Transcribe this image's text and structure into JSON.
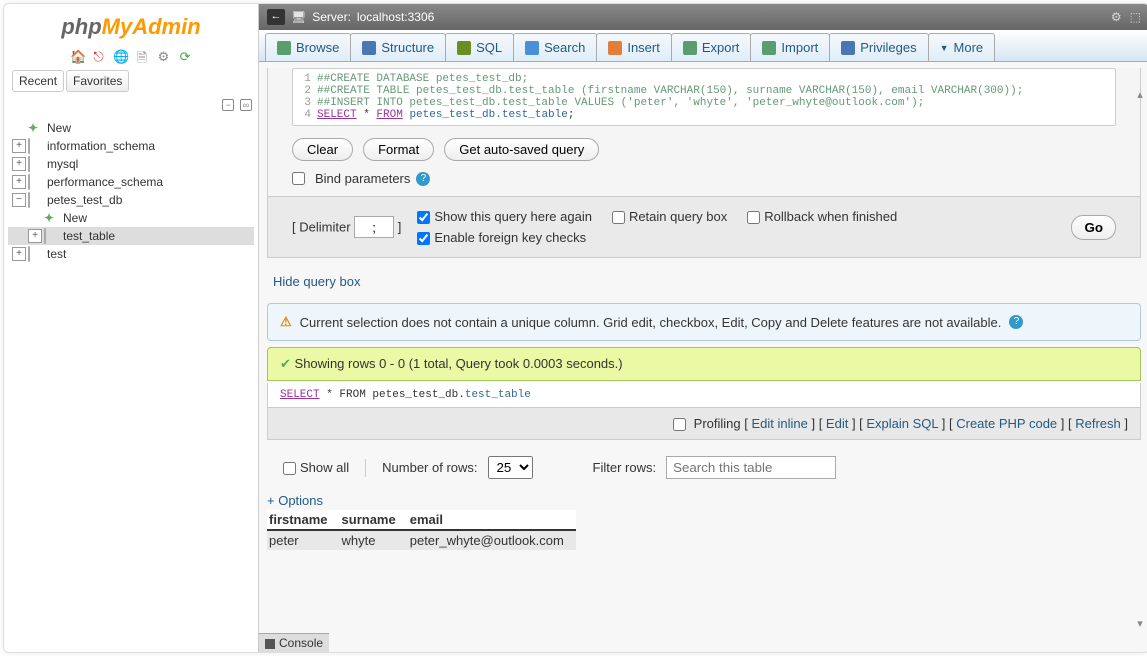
{
  "logo": {
    "php": "php",
    "myadmin": "MyAdmin"
  },
  "sidebar": {
    "tabs": [
      "Recent",
      "Favorites"
    ],
    "tree": [
      {
        "label": "New",
        "type": "new",
        "indent": 0
      },
      {
        "label": "information_schema",
        "type": "db",
        "indent": 0,
        "toggle": "+"
      },
      {
        "label": "mysql",
        "type": "db",
        "indent": 0,
        "toggle": "+"
      },
      {
        "label": "performance_schema",
        "type": "db",
        "indent": 0,
        "toggle": "+"
      },
      {
        "label": "petes_test_db",
        "type": "db",
        "indent": 0,
        "toggle": "−"
      },
      {
        "label": "New",
        "type": "new",
        "indent": 1
      },
      {
        "label": "test_table",
        "type": "table",
        "indent": 1,
        "toggle": "+",
        "selected": true
      },
      {
        "label": "test",
        "type": "db",
        "indent": 0,
        "toggle": "+"
      }
    ]
  },
  "server": {
    "label": "Server:",
    "value": "localhost:3306"
  },
  "tabs": [
    {
      "label": "Browse",
      "icon": "#5a9e6f"
    },
    {
      "label": "Structure",
      "icon": "#4a77b4"
    },
    {
      "label": "SQL",
      "icon": "#6b8e23"
    },
    {
      "label": "Search",
      "icon": "#4a90d9"
    },
    {
      "label": "Insert",
      "icon": "#e27d3a"
    },
    {
      "label": "Export",
      "icon": "#5a9e6f"
    },
    {
      "label": "Import",
      "icon": "#5a9e6f"
    },
    {
      "label": "Privileges",
      "icon": "#4a77b4"
    },
    {
      "label": "More",
      "icon": "#333",
      "caret": true
    }
  ],
  "code": [
    {
      "n": "1",
      "text": "##CREATE DATABASE petes_test_db;",
      "cls": "cm-comment"
    },
    {
      "n": "2",
      "text": "##CREATE TABLE petes_test_db.test_table (firstname VARCHAR(150), surname VARCHAR(150), email VARCHAR(300));",
      "cls": "cm-comment"
    },
    {
      "n": "3",
      "text": "##INSERT INTO petes_test_db.test_table VALUES ('peter', 'whyte', 'peter_whyte@outlook.com');",
      "cls": "cm-comment"
    },
    {
      "n": "4",
      "html": "<span class='cm-keyword'>SELECT</span> * <span class='cm-keyword'>FROM</span> <span class='cm-table'>petes_test_db.test_table</span>;"
    }
  ],
  "buttons": {
    "clear": "Clear",
    "format": "Format",
    "autosaved": "Get auto-saved query"
  },
  "bind": {
    "label": "Bind parameters"
  },
  "opts": {
    "delimiter_label": "Delimiter",
    "delimiter_value": ";",
    "show_again": "Show this query here again",
    "retain": "Retain query box",
    "rollback": "Rollback when finished",
    "fk": "Enable foreign key checks",
    "go": "Go"
  },
  "hide_link": "Hide query box",
  "alert": "Current selection does not contain a unique column. Grid edit, checkbox, Edit, Copy and Delete features are not available.",
  "success": "Showing rows 0 - 0 (1 total, Query took 0.0003 seconds.)",
  "shown_query": {
    "sel": "SELECT",
    "rest": " * FROM petes_test_db.",
    "tbl": "test_table"
  },
  "actions": {
    "profiling": "Profiling",
    "links": [
      "Edit inline",
      "Edit",
      "Explain SQL",
      "Create PHP code",
      "Refresh"
    ]
  },
  "filter": {
    "showall": "Show all",
    "numrows_label": "Number of rows:",
    "numrows_val": "25",
    "filter_label": "Filter rows:",
    "placeholder": "Search this table"
  },
  "plus_opts": "+ Options",
  "table": {
    "cols": [
      "firstname",
      "surname",
      "email"
    ],
    "rows": [
      [
        "peter",
        "whyte",
        "peter_whyte@outlook.com"
      ]
    ]
  },
  "console": "Console"
}
